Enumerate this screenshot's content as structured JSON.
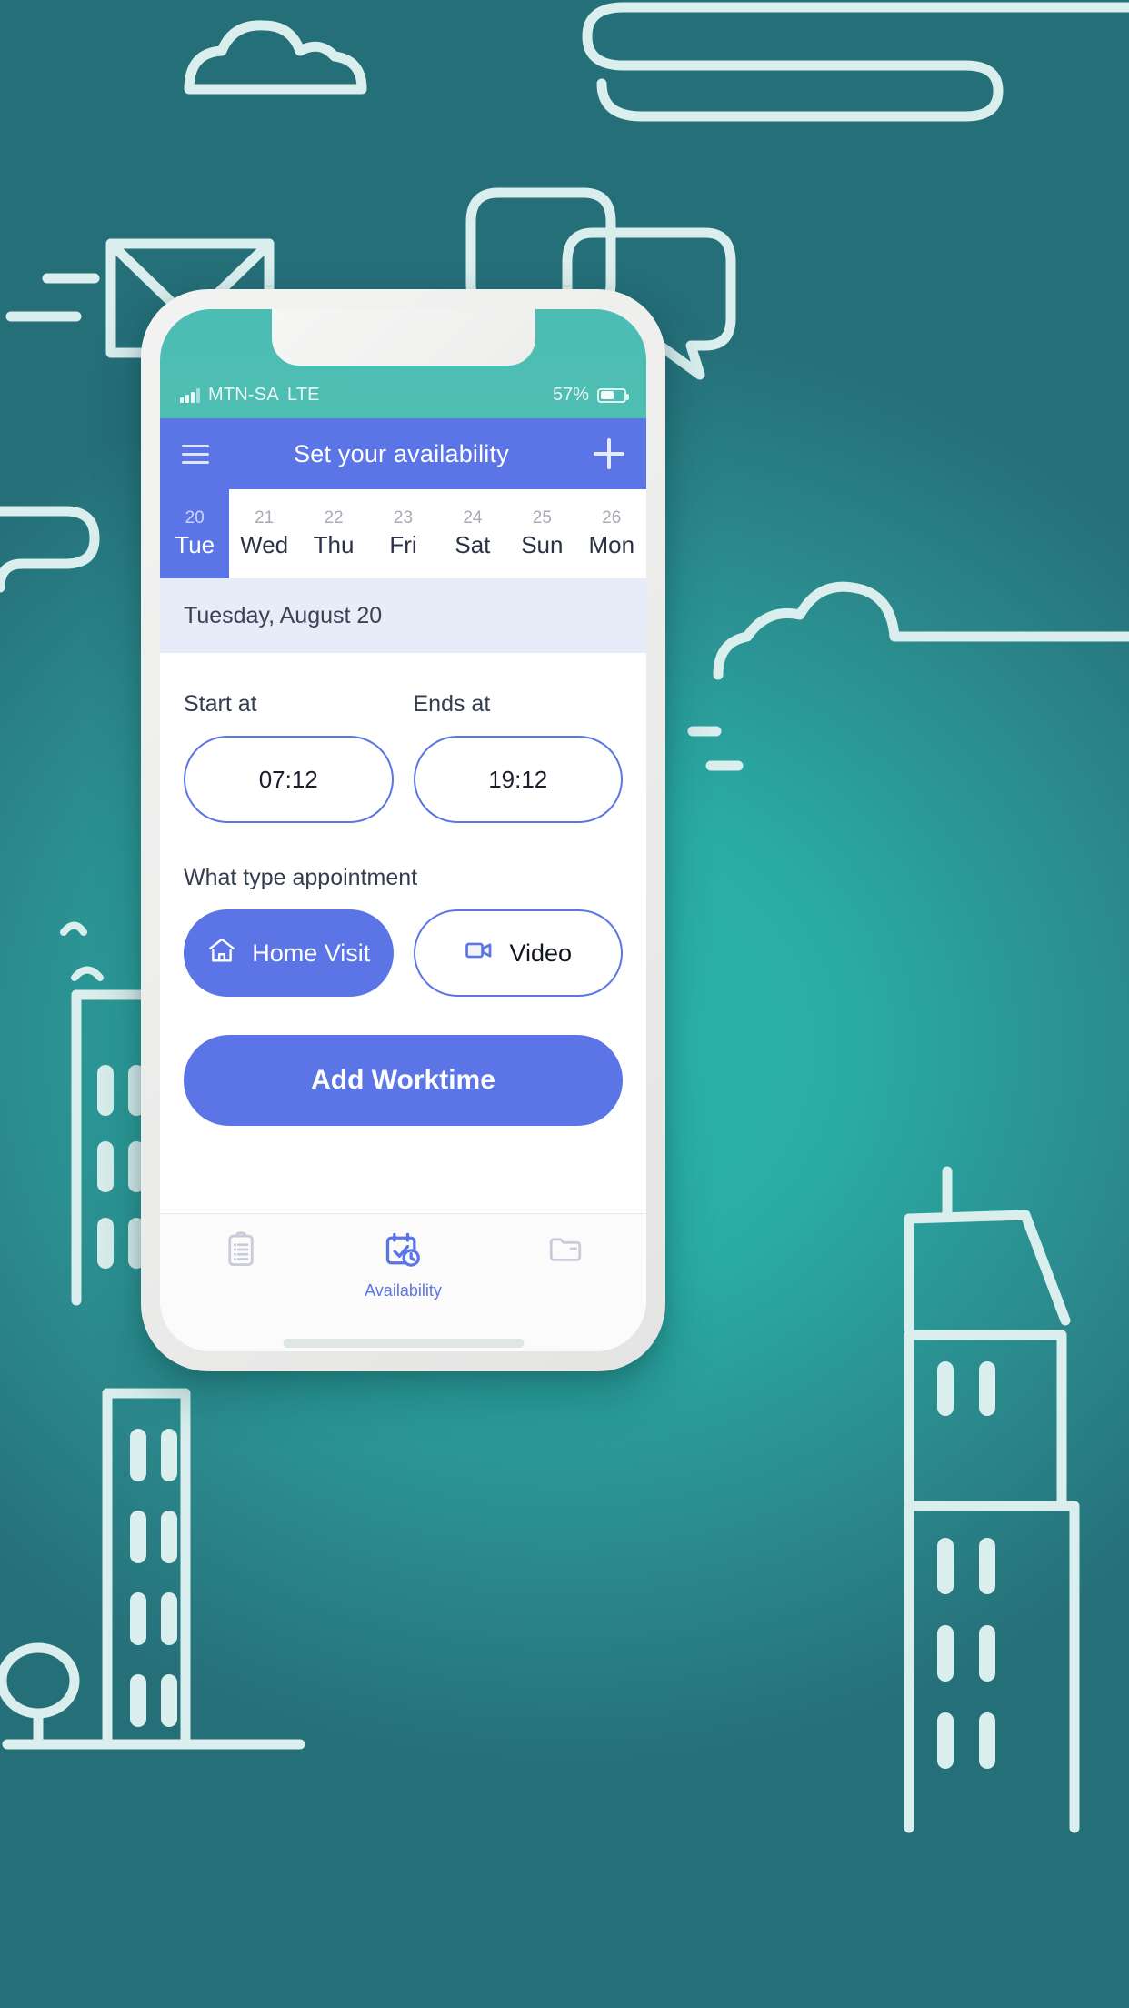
{
  "scene": {
    "background_color": "#2aa99f",
    "illustration_stroke": "#d9eeed",
    "illustration_items": [
      "cloud-icon",
      "squiggle-icon",
      "envelope-icon",
      "speech-bubble-icon",
      "speech-bubble-icon",
      "cloud-icon",
      "bird-icon",
      "building-icon",
      "building-icon",
      "building-icon",
      "tree-icon",
      "dash-icon"
    ]
  },
  "device": {
    "frame_color": "#ececeb",
    "home_indicator": "home-indicator"
  },
  "status_bar": {
    "carrier": "MTN-SA",
    "network": "LTE",
    "battery_percent": "57%",
    "battery_level": 57,
    "signal_icon": "signal-bars-icon",
    "battery_icon": "battery-icon"
  },
  "app_bar": {
    "menu_icon": "hamburger-menu-icon",
    "title": "Set your availability",
    "add_icon": "plus-icon",
    "background_color": "#5b75e6"
  },
  "date_strip": {
    "days": [
      {
        "num": "20",
        "name": "Tue",
        "selected": true
      },
      {
        "num": "21",
        "name": "Wed",
        "selected": false
      },
      {
        "num": "22",
        "name": "Thu",
        "selected": false
      },
      {
        "num": "23",
        "name": "Fri",
        "selected": false
      },
      {
        "num": "24",
        "name": "Sat",
        "selected": false
      },
      {
        "num": "25",
        "name": "Sun",
        "selected": false
      },
      {
        "num": "26",
        "name": "Mon",
        "selected": false
      }
    ]
  },
  "selected_date_banner": {
    "text": "Tuesday, August 20",
    "background_color": "#e8ebf8"
  },
  "form": {
    "start": {
      "label": "Start at",
      "value": "07:12"
    },
    "end": {
      "label": "Ends at",
      "value": "19:12"
    },
    "type_section_label": "What type appointment",
    "types": [
      {
        "label": "Home Visit",
        "icon": "home-icon",
        "selected": true
      },
      {
        "label": "Video",
        "icon": "video-camera-icon",
        "selected": false
      }
    ],
    "submit_label": "Add Worktime"
  },
  "bottom_nav": {
    "items": [
      {
        "label": "",
        "icon": "clipboard-icon",
        "active": false
      },
      {
        "label": "Availability",
        "icon": "calendar-clock-icon",
        "active": true
      },
      {
        "label": "",
        "icon": "folder-icon",
        "active": false
      }
    ],
    "active_color": "#5b75e6",
    "inactive_color": "#c9ccd8"
  }
}
